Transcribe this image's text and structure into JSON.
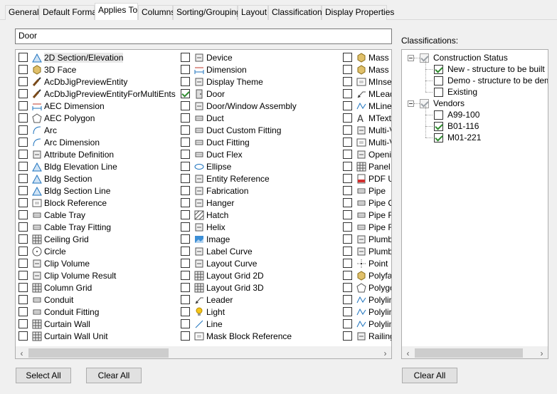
{
  "tabs": [
    {
      "label": "General",
      "active": false
    },
    {
      "label": "Default Format",
      "active": false
    },
    {
      "label": "Applies To",
      "active": true
    },
    {
      "label": "Columns",
      "active": false
    },
    {
      "label": "Sorting/Grouping",
      "active": false
    },
    {
      "label": "Layout",
      "active": false
    },
    {
      "label": "Classifications",
      "active": false
    },
    {
      "label": "Display Properties",
      "active": false
    }
  ],
  "search": {
    "value": "Door"
  },
  "objects": {
    "columns": [
      [
        {
          "label": "2D Section/Elevation",
          "icon": "section-elevation-icon",
          "checked": false
        },
        {
          "label": "3D Face",
          "icon": "3d-face-icon",
          "checked": false
        },
        {
          "label": "AcDbJigPreviewEntity",
          "icon": "brush-icon",
          "checked": false
        },
        {
          "label": "AcDbJigPreviewEntityForMultiEnts",
          "icon": "brush-icon",
          "checked": false
        },
        {
          "label": "AEC Dimension",
          "icon": "aec-dimension-icon",
          "checked": false
        },
        {
          "label": "AEC Polygon",
          "icon": "polygon-icon",
          "checked": false
        },
        {
          "label": "Arc",
          "icon": "arc-icon",
          "checked": false
        },
        {
          "label": "Arc Dimension",
          "icon": "arc-dimension-icon",
          "checked": false
        },
        {
          "label": "Attribute Definition",
          "icon": "attribute-icon",
          "checked": false
        },
        {
          "label": "Bldg Elevation Line",
          "icon": "elevation-line-icon",
          "checked": false
        },
        {
          "label": "Bldg Section",
          "icon": "bldg-section-icon",
          "checked": false
        },
        {
          "label": "Bldg Section Line",
          "icon": "section-line-icon",
          "checked": false
        },
        {
          "label": "Block Reference",
          "icon": "block-reference-icon",
          "checked": false
        },
        {
          "label": "Cable Tray",
          "icon": "cable-tray-icon",
          "checked": false
        },
        {
          "label": "Cable Tray Fitting",
          "icon": "cable-tray-fitting-icon",
          "checked": false
        },
        {
          "label": "Ceiling Grid",
          "icon": "ceiling-grid-icon",
          "checked": false
        },
        {
          "label": "Circle",
          "icon": "circle-icon",
          "checked": false
        },
        {
          "label": "Clip Volume",
          "icon": "clip-volume-icon",
          "checked": false
        },
        {
          "label": "Clip Volume Result",
          "icon": "clip-volume-result-icon",
          "checked": false
        },
        {
          "label": "Column Grid",
          "icon": "column-grid-icon",
          "checked": false
        },
        {
          "label": "Conduit",
          "icon": "conduit-icon",
          "checked": false
        },
        {
          "label": "Conduit Fitting",
          "icon": "conduit-fitting-icon",
          "checked": false
        },
        {
          "label": "Curtain Wall",
          "icon": "curtain-wall-icon",
          "checked": false
        },
        {
          "label": "Curtain Wall Unit",
          "icon": "curtain-wall-unit-icon",
          "checked": false
        }
      ],
      [
        {
          "label": "Device",
          "icon": "device-icon",
          "checked": false
        },
        {
          "label": "Dimension",
          "icon": "dimension-icon",
          "checked": false
        },
        {
          "label": "Display Theme",
          "icon": "display-theme-icon",
          "checked": false
        },
        {
          "label": "Door",
          "icon": "door-icon",
          "checked": true
        },
        {
          "label": "Door/Window Assembly",
          "icon": "door-window-assembly-icon",
          "checked": false
        },
        {
          "label": "Duct",
          "icon": "duct-icon",
          "checked": false
        },
        {
          "label": "Duct Custom Fitting",
          "icon": "duct-custom-fitting-icon",
          "checked": false
        },
        {
          "label": "Duct Fitting",
          "icon": "duct-fitting-icon",
          "checked": false
        },
        {
          "label": "Duct Flex",
          "icon": "duct-flex-icon",
          "checked": false
        },
        {
          "label": "Ellipse",
          "icon": "ellipse-icon",
          "checked": false
        },
        {
          "label": "Entity Reference",
          "icon": "entity-reference-icon",
          "checked": false
        },
        {
          "label": "Fabrication",
          "icon": "fabrication-icon",
          "checked": false
        },
        {
          "label": "Hanger",
          "icon": "hanger-icon",
          "checked": false
        },
        {
          "label": "Hatch",
          "icon": "hatch-icon",
          "checked": false
        },
        {
          "label": "Helix",
          "icon": "helix-icon",
          "checked": false
        },
        {
          "label": "Image",
          "icon": "image-icon",
          "checked": false
        },
        {
          "label": "Label Curve",
          "icon": "label-curve-icon",
          "checked": false
        },
        {
          "label": "Layout Curve",
          "icon": "layout-curve-icon",
          "checked": false
        },
        {
          "label": "Layout Grid 2D",
          "icon": "layout-grid-2d-icon",
          "checked": false
        },
        {
          "label": "Layout Grid 3D",
          "icon": "layout-grid-3d-icon",
          "checked": false
        },
        {
          "label": "Leader",
          "icon": "leader-icon",
          "checked": false
        },
        {
          "label": "Light",
          "icon": "light-icon",
          "checked": false
        },
        {
          "label": "Line",
          "icon": "line-icon",
          "checked": false
        },
        {
          "label": "Mask Block Reference",
          "icon": "mask-block-icon",
          "checked": false
        }
      ],
      [
        {
          "label": "Mass E",
          "icon": "mass-element-icon",
          "checked": false
        },
        {
          "label": "Mass G",
          "icon": "mass-group-icon",
          "checked": false
        },
        {
          "label": "MInser",
          "icon": "minsert-icon",
          "checked": false
        },
        {
          "label": "MLead",
          "icon": "mleader-icon",
          "checked": false
        },
        {
          "label": "MLine",
          "icon": "mline-icon",
          "checked": false
        },
        {
          "label": "MText",
          "icon": "mtext-icon",
          "checked": false
        },
        {
          "label": "Multi-V",
          "icon": "multi-view-icon",
          "checked": false
        },
        {
          "label": "Multi-V",
          "icon": "multi-view-block-icon",
          "checked": false
        },
        {
          "label": "Openin",
          "icon": "opening-icon",
          "checked": false
        },
        {
          "label": "Panel",
          "icon": "panel-icon",
          "checked": false
        },
        {
          "label": "PDF Ur",
          "icon": "pdf-icon",
          "checked": false
        },
        {
          "label": "Pipe",
          "icon": "pipe-icon",
          "checked": false
        },
        {
          "label": "Pipe C",
          "icon": "pipe-custom-icon",
          "checked": false
        },
        {
          "label": "Pipe Fi",
          "icon": "pipe-fitting-icon",
          "checked": false
        },
        {
          "label": "Pipe Fl",
          "icon": "pipe-flex-icon",
          "checked": false
        },
        {
          "label": "Plumb",
          "icon": "plumbing-icon",
          "checked": false
        },
        {
          "label": "Plumb",
          "icon": "plumbing-line-icon",
          "checked": false
        },
        {
          "label": "Point",
          "icon": "point-icon",
          "checked": false
        },
        {
          "label": "Polyfa",
          "icon": "polyface-icon",
          "checked": false
        },
        {
          "label": "Polygo",
          "icon": "polygon-mesh-icon",
          "checked": false
        },
        {
          "label": "Polylin",
          "icon": "polyline-icon",
          "checked": false
        },
        {
          "label": "Polylin",
          "icon": "polyline-2d-icon",
          "checked": false
        },
        {
          "label": "Polylin",
          "icon": "polyline-3d-icon",
          "checked": false
        },
        {
          "label": "Railing",
          "icon": "railing-icon",
          "checked": false
        }
      ]
    ]
  },
  "classifications": {
    "label": "Classifications:",
    "groups": [
      {
        "label": "Construction Status",
        "checked": true,
        "children": [
          {
            "label": "New - structure to be built",
            "checked": true
          },
          {
            "label": "Demo - structure to be demolis",
            "checked": false
          },
          {
            "label": "Existing",
            "checked": false
          }
        ]
      },
      {
        "label": "Vendors",
        "checked": true,
        "children": [
          {
            "label": "A99-100",
            "checked": false
          },
          {
            "label": "B01-116",
            "checked": true
          },
          {
            "label": "M01-221",
            "checked": true
          }
        ]
      }
    ]
  },
  "buttons": {
    "select_all": "Select All",
    "clear_all": "Clear All",
    "clear_all_classifications": "Clear All"
  }
}
